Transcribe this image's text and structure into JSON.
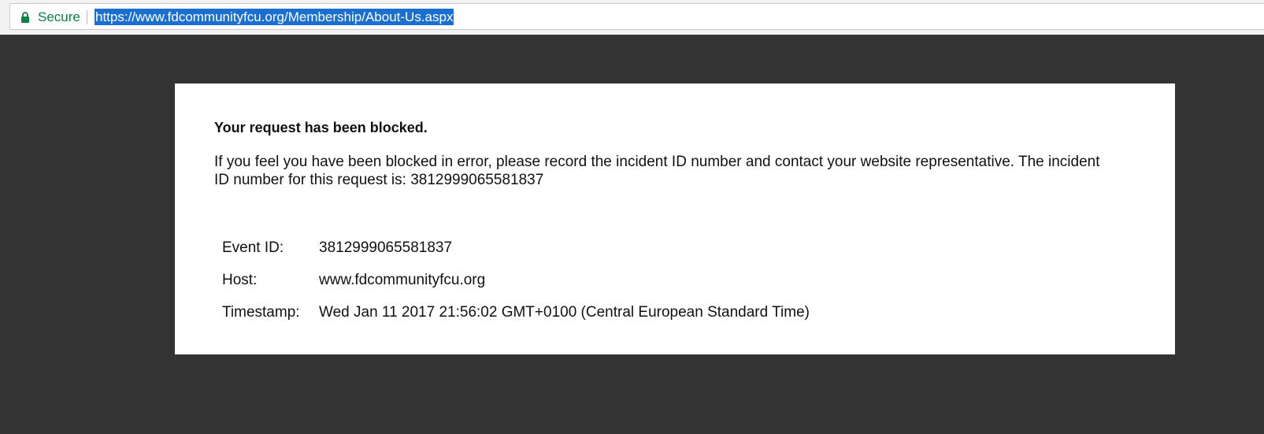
{
  "browser": {
    "security_label": "Secure",
    "url": "https://www.fdcommunityfcu.org/Membership/About-Us.aspx",
    "lock_icon": "lock-icon",
    "secure_color": "#0b8043",
    "selection_color": "#1b6fd1"
  },
  "page": {
    "background_color": "#333333",
    "title": "Your request has been blocked.",
    "message": "If you feel you have been blocked in error, please record the incident ID number and contact your website representative. The incident ID number for this request is: 3812999065581837",
    "details": [
      {
        "label": "Event ID:",
        "value": "3812999065581837"
      },
      {
        "label": "Host:",
        "value": "www.fdcommunityfcu.org"
      },
      {
        "label": "Timestamp:",
        "value": "Wed Jan 11 2017 21:56:02 GMT+0100 (Central European Standard Time)"
      }
    ]
  }
}
